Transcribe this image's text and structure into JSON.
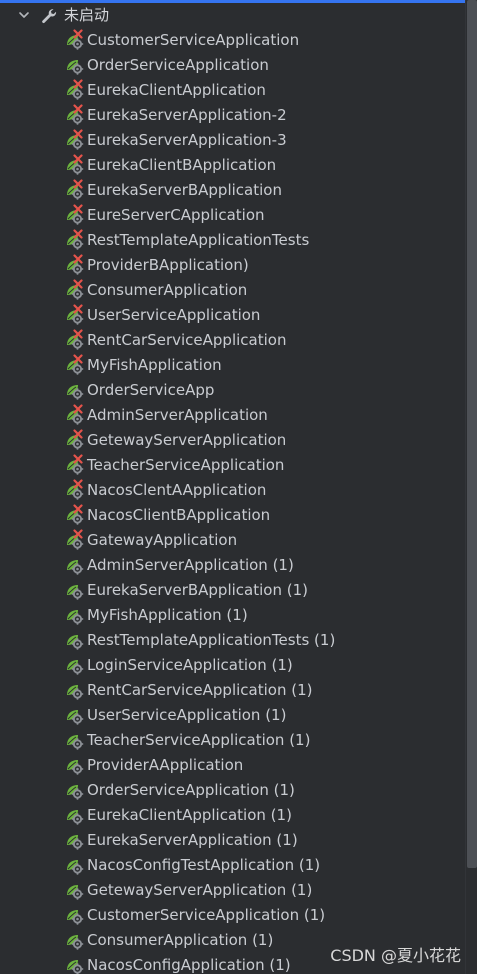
{
  "group": {
    "label": "未启动",
    "expanded": true,
    "icon": "wrench-icon"
  },
  "items": [
    {
      "label": "CustomerServiceApplication",
      "status": "error"
    },
    {
      "label": "OrderServiceApplication",
      "status": "normal"
    },
    {
      "label": "EurekaClientApplication",
      "status": "error"
    },
    {
      "label": "EurekaServerApplication-2",
      "status": "error"
    },
    {
      "label": "EurekaServerApplication-3",
      "status": "error"
    },
    {
      "label": "EurekaClientBApplication",
      "status": "error"
    },
    {
      "label": "EurekaServerBApplication",
      "status": "error"
    },
    {
      "label": "EureServerCApplication",
      "status": "error"
    },
    {
      "label": "RestTemplateApplicationTests",
      "status": "error"
    },
    {
      "label": "ProviderBApplication)",
      "status": "error"
    },
    {
      "label": "ConsumerApplication",
      "status": "error"
    },
    {
      "label": "UserServiceApplication",
      "status": "error"
    },
    {
      "label": "RentCarServiceApplication",
      "status": "error"
    },
    {
      "label": "MyFishApplication",
      "status": "error"
    },
    {
      "label": "OrderServiceApp",
      "status": "normal"
    },
    {
      "label": "AdminServerApplication",
      "status": "error"
    },
    {
      "label": "GetewayServerApplication",
      "status": "error"
    },
    {
      "label": "TeacherServiceApplication",
      "status": "error"
    },
    {
      "label": "NacosClentAApplication",
      "status": "error"
    },
    {
      "label": "NacosClientBApplication",
      "status": "error"
    },
    {
      "label": "GatewayApplication",
      "status": "error"
    },
    {
      "label": "AdminServerApplication (1)",
      "status": "normal"
    },
    {
      "label": "EurekaServerBApplication (1)",
      "status": "normal"
    },
    {
      "label": "MyFishApplication (1)",
      "status": "normal"
    },
    {
      "label": "RestTemplateApplicationTests (1)",
      "status": "normal"
    },
    {
      "label": "LoginServiceApplication (1)",
      "status": "normal"
    },
    {
      "label": "RentCarServiceApplication (1)",
      "status": "normal"
    },
    {
      "label": "UserServiceApplication (1)",
      "status": "normal"
    },
    {
      "label": "TeacherServiceApplication (1)",
      "status": "normal"
    },
    {
      "label": "ProviderAApplication",
      "status": "normal"
    },
    {
      "label": "OrderServiceApplication (1)",
      "status": "normal"
    },
    {
      "label": "EurekaClientApplication (1)",
      "status": "normal"
    },
    {
      "label": "EurekaServerApplication (1)",
      "status": "normal"
    },
    {
      "label": "NacosConfigTestApplication (1)",
      "status": "normal"
    },
    {
      "label": "GetewayServerApplication (1)",
      "status": "normal"
    },
    {
      "label": "CustomerServiceApplication (1)",
      "status": "normal"
    },
    {
      "label": "ConsumerApplication (1)",
      "status": "normal"
    },
    {
      "label": "NacosConfigApplication (1)",
      "status": "normal"
    }
  ],
  "watermark": "CSDN @夏小花花",
  "colors": {
    "background": "#2b2d30",
    "text": "#c9ccd1",
    "spring_green": "#6cb33e",
    "error_red": "#e5534b",
    "accent": "#3574f0"
  }
}
